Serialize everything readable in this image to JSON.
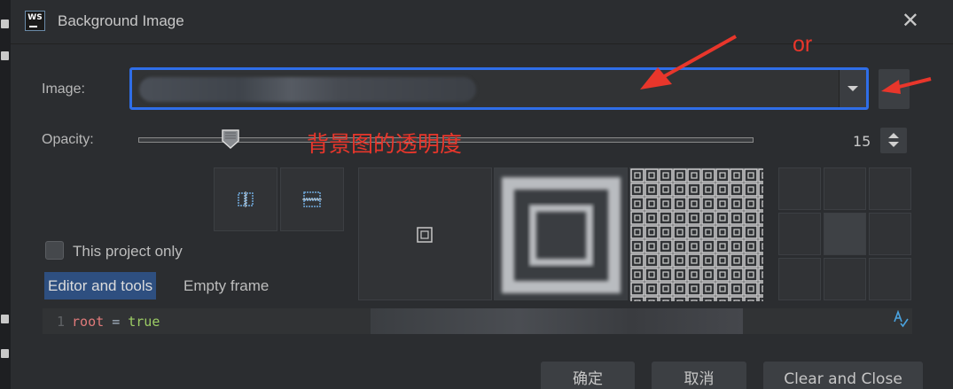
{
  "window": {
    "title": "Background Image",
    "logo_text": "WS",
    "close_glyph": "✕"
  },
  "form": {
    "image_label": "Image:",
    "opacity_label": "Opacity:",
    "opacity_value": "15",
    "opacity_max": 100
  },
  "annotations": {
    "opacity_note": "背景图的透明度",
    "or_note": "or",
    "color": "#e8362b"
  },
  "options": {
    "this_project_only": "This project only",
    "tab_editor": "Editor and tools",
    "tab_empty": "Empty frame"
  },
  "code": {
    "line_number": "1",
    "key": "root",
    "operator": "=",
    "value": "true"
  },
  "buttons": {
    "ok": "确定",
    "cancel": "取消",
    "clear_close": "Clear and Close"
  },
  "colors": {
    "accent": "#2f6ee8",
    "selected_tab": "#2e4f80",
    "background": "#2b2d30"
  },
  "icons": {
    "spell_check": "A"
  }
}
